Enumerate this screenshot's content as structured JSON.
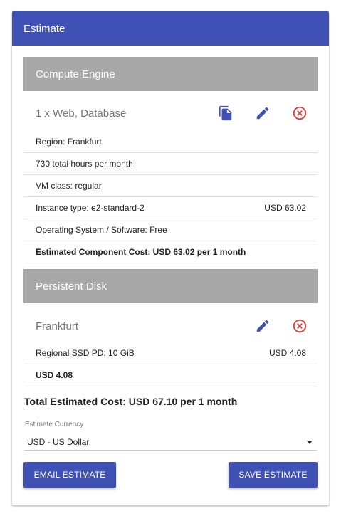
{
  "card": {
    "title": "Estimate"
  },
  "compute": {
    "header": "Compute Engine",
    "title": "1 x Web, Database",
    "rows": [
      {
        "label": "Region: Frankfurt",
        "value": ""
      },
      {
        "label": "730 total hours per month",
        "value": ""
      },
      {
        "label": "VM class: regular",
        "value": ""
      },
      {
        "label": "Instance type: e2-standard-2",
        "value": "USD 63.02"
      },
      {
        "label": "Operating System / Software: Free",
        "value": ""
      },
      {
        "label": "Estimated Component Cost: USD 63.02 per 1 month",
        "value": ""
      }
    ]
  },
  "disk": {
    "header": "Persistent Disk",
    "title": "Frankfurt",
    "rows": [
      {
        "label": "Regional SSD PD: 10 GiB",
        "value": "USD 4.08"
      },
      {
        "label": "USD 4.08",
        "value": ""
      }
    ]
  },
  "total": "Total Estimated Cost: USD 67.10 per 1 month",
  "currency": {
    "label": "Estimate Currency",
    "value": "USD - US Dollar"
  },
  "buttons": {
    "email": "EMAIL ESTIMATE",
    "save": "SAVE ESTIMATE"
  },
  "colors": {
    "primary": "#3f51b5",
    "section": "#a8a8a8",
    "danger": "#e53935"
  }
}
